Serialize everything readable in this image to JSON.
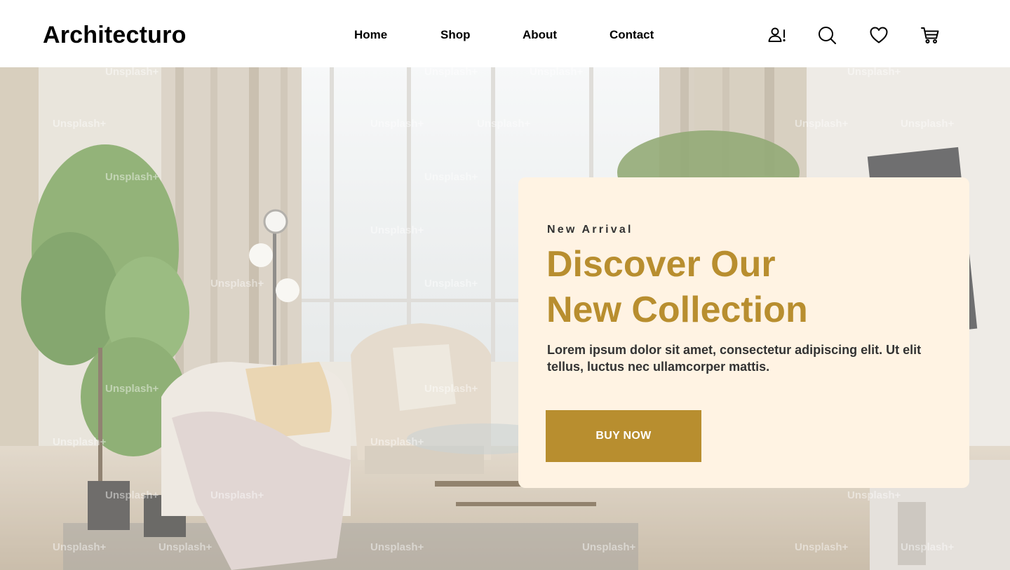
{
  "brand": {
    "logo": "Architecturo"
  },
  "nav": {
    "items": [
      {
        "label": "Home"
      },
      {
        "label": "Shop"
      },
      {
        "label": "About"
      },
      {
        "label": "Contact"
      }
    ]
  },
  "header_icons": [
    {
      "name": "account-alert-icon"
    },
    {
      "name": "search-icon"
    },
    {
      "name": "heart-icon"
    },
    {
      "name": "cart-icon"
    }
  ],
  "hero": {
    "watermark_text": "Unsplash+",
    "card": {
      "eyebrow": "New Arrival",
      "headline_line1": "Discover Our",
      "headline_line2": "New Collection",
      "description": "Lorem ipsum dolor sit amet, consectetur adipiscing elit. Ut elit tellus, luctus nec ullamcorper mattis.",
      "cta_label": "BUY NOW"
    }
  },
  "colors": {
    "accent": "#B88E2F",
    "card_background": "#FFF3E3",
    "text_dark": "#333333",
    "header_background": "#FFFFFF"
  }
}
